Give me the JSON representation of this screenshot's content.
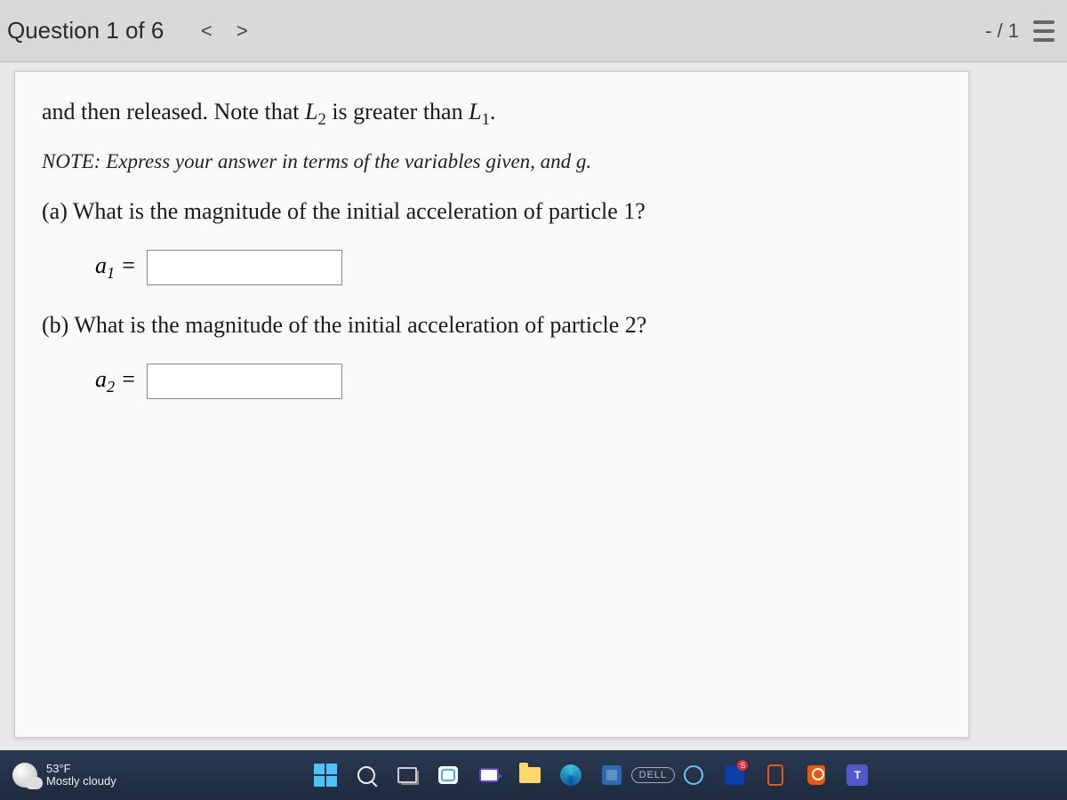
{
  "header": {
    "question_label": "Question 1 of 6",
    "prev_glyph": "<",
    "next_glyph": ">",
    "score": "- / 1"
  },
  "problem": {
    "intro_html": "and then released. Note that <span class='ital'>L</span><sub>2</sub> is greater than <span class='ital'>L</span><sub>1</sub>.",
    "note_html": "NOTE: Express your answer in terms of the variables given, and g.",
    "part_a": {
      "prompt": "(a) What is the magnitude of the initial acceleration of particle 1?",
      "var_prefix": "a",
      "var_sub": "1",
      "value": ""
    },
    "part_b": {
      "prompt": "(b) What is the magnitude of the initial acceleration of particle 2?",
      "var_prefix": "a",
      "var_sub": "2",
      "value": ""
    }
  },
  "taskbar": {
    "weather": {
      "temp": "53°F",
      "cond": "Mostly cloudy"
    },
    "dell": "DELL"
  }
}
